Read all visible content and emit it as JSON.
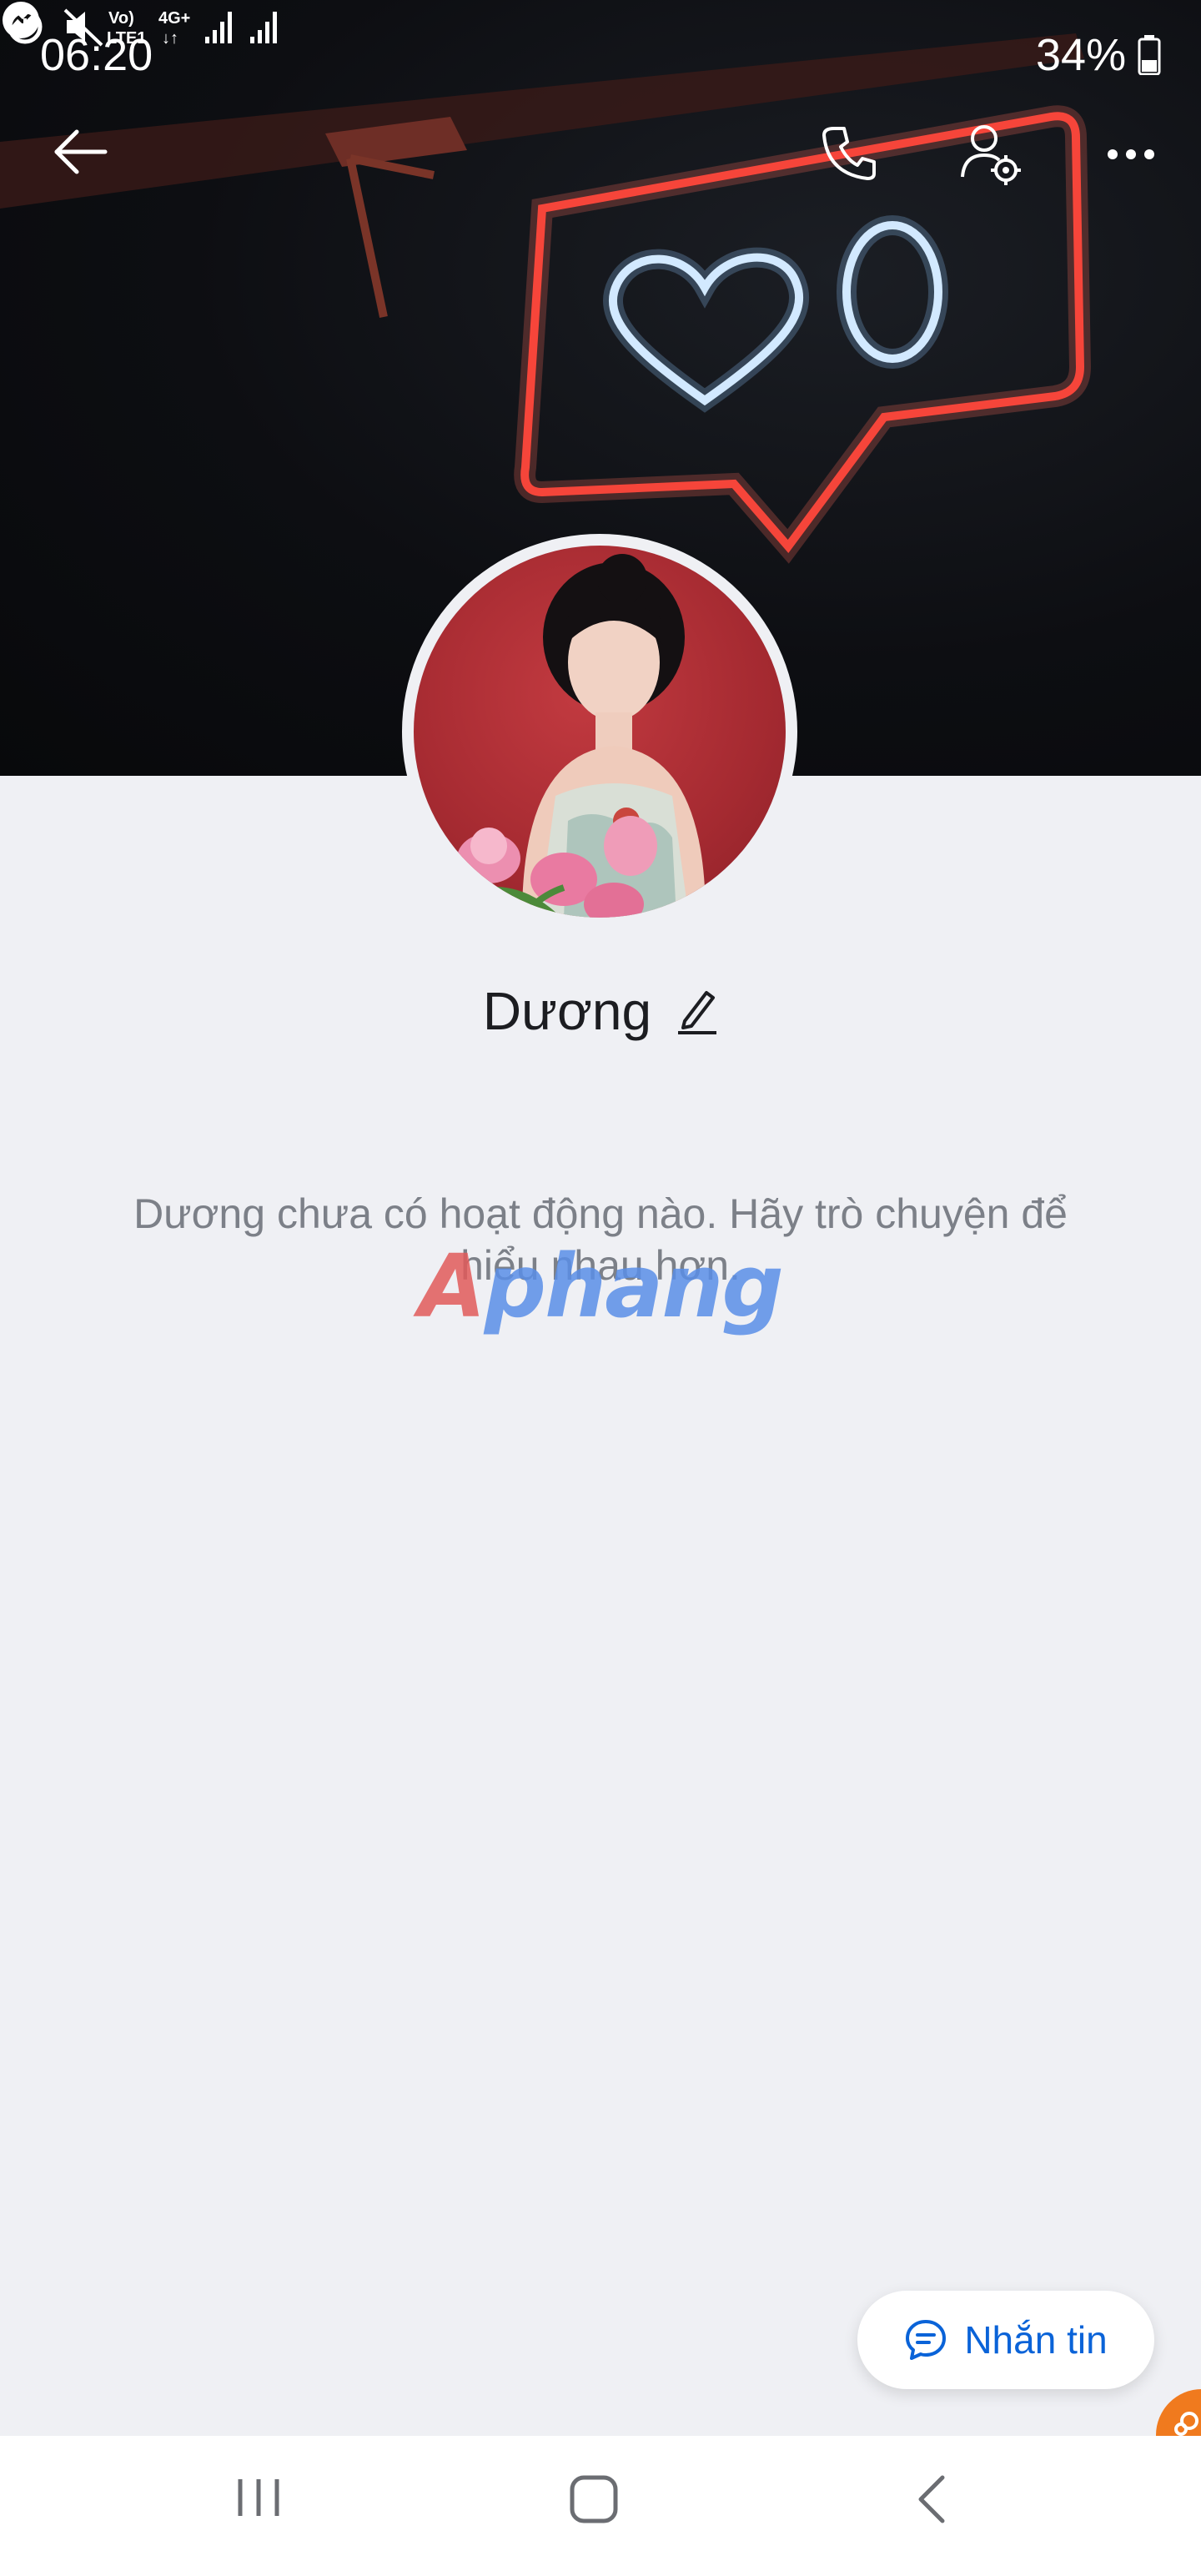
{
  "status_bar": {
    "time": "06:20",
    "battery_percent": "34%",
    "network_label_top": "Vo)",
    "network_label_bottom": "LTE1",
    "network_type": "4G+",
    "icons": [
      "messenger-icon",
      "alarm-icon",
      "mute-icon",
      "volte-icon",
      "4g-icon",
      "signal-icon",
      "signal-icon",
      "battery-icon"
    ]
  },
  "toolbar": {
    "icons": [
      "back-arrow-icon",
      "phone-icon",
      "user-settings-icon",
      "more-icon"
    ]
  },
  "profile": {
    "name": "Dương",
    "empty_message": "Dương chưa có hoạt động nào. Hãy trò chuyện để hiểu nhau hơn."
  },
  "watermark": {
    "text_first": "A",
    "text_rest": "phang"
  },
  "message_button": {
    "label": "Nhắn tin",
    "icon": "chat-bubble-icon"
  },
  "nav_bar": {
    "icons": [
      "recents-icon",
      "home-icon",
      "back-icon"
    ]
  },
  "colors": {
    "accent": "#0a63d8",
    "background": "#eff0f4",
    "neon_red": "#ff3b30",
    "neon_blue": "#d8ecff"
  }
}
